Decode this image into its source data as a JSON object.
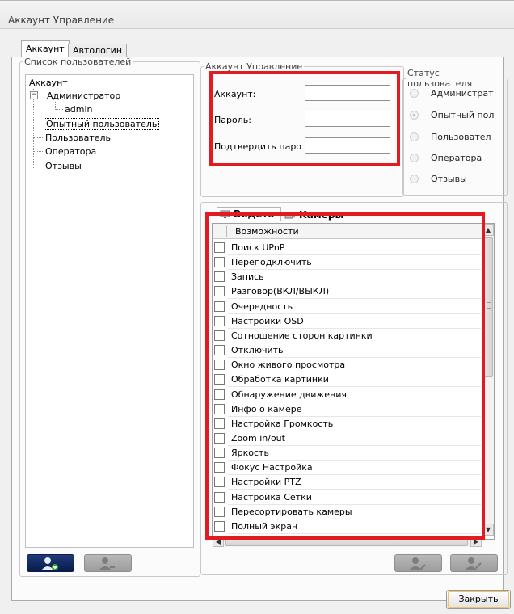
{
  "window": {
    "title": "Аккаунт Управление"
  },
  "tabs": [
    {
      "label": "Аккаунт"
    },
    {
      "label": "Автологин"
    }
  ],
  "users_group": {
    "legend": "Список пользователей",
    "root": "Аккаунт",
    "nodes": [
      "Администратор",
      "admin",
      "Опытный пользователь",
      "Пользователь",
      "Оператора",
      "Отзывы"
    ]
  },
  "account_group": {
    "legend": "Аккаунт Управление",
    "account_label": "Аккаунт:",
    "password_label": "Пароль:",
    "confirm_label": "Подтвердить паро"
  },
  "status_group": {
    "legend": "Статус пользователя",
    "options": [
      "Администрат",
      "Опытный пол",
      "Пользовател",
      "Оператора",
      "Отзывы"
    ],
    "selected": "Опытный пол"
  },
  "sub_tabs": [
    {
      "label": "Видеть"
    },
    {
      "label": "Камеры"
    }
  ],
  "capabilities": {
    "header": "Возможности",
    "items": [
      "Поиск UPnP",
      "Переподключить",
      "Запись",
      "Разговор(ВКЛ/ВЫКЛ)",
      "Очередность",
      "Настройки OSD",
      "Сотношение сторон картинки",
      "Отключить",
      "Окно живого просмотра",
      "Обработка картинки",
      "Обнаружение движения",
      "Инфо о камере",
      "Настройка Громкость",
      "Zoom in/out",
      "Яркость",
      "Фокус Настройка",
      "Настройки PTZ",
      "Настройка Сетки",
      "Пересортировать камеры",
      "Полный экран"
    ]
  },
  "buttons": {
    "close": "Закрыть"
  },
  "icons": {
    "add_user": "add-user-icon",
    "remove_user": "remove-user-icon",
    "edit_user": "edit-user-icon",
    "save_user": "save-user-icon"
  },
  "colors": {
    "highlight": "#e21b22",
    "active_button": "#1f3b7a",
    "disabled_button": "#a6a6a6"
  }
}
